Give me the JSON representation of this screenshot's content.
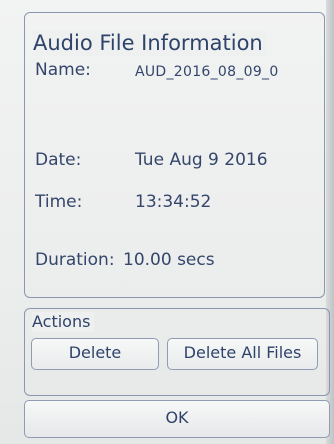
{
  "dialog": {
    "title": "Audio File Information",
    "fields": [
      {
        "label": "Name:",
        "value": "AUD_2016_08_09_0"
      },
      {
        "label": "Date:",
        "value": "Tue Aug 9 2016"
      },
      {
        "label": "Time:",
        "value": "13:34:52"
      },
      {
        "label": "Duration:",
        "value": "10.00 secs"
      }
    ]
  },
  "actions": {
    "title": "Actions",
    "delete_label": "Delete",
    "delete_all_label": "Delete All Files"
  },
  "ok_label": "OK"
}
